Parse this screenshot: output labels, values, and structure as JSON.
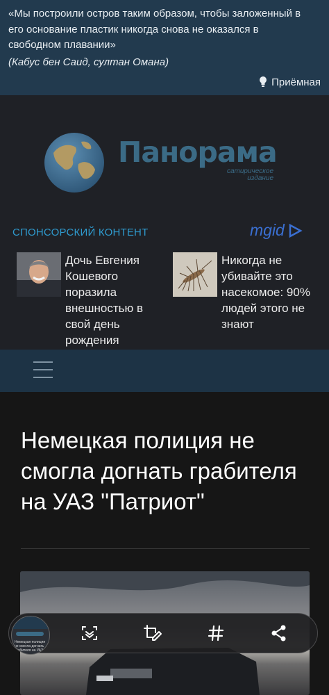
{
  "quote": {
    "text": "«Мы построили остров таким образом, чтобы заложенный в его основание пластик никогда снова не оказался в свободном плавании»",
    "author": "(Кабус бен Саид, султан Омана)",
    "reception_label": "Приёмная"
  },
  "logo": {
    "title": "Панорама",
    "subtitle_line1": "сатирическое",
    "subtitle_line2": "издание"
  },
  "sponsored": {
    "label": "СПОНСОРСКИЙ КОНТЕНТ",
    "network": "mgid",
    "ads": [
      {
        "title": "Дочь Евгения Кошевого поразила внешностью в свой день рождения"
      },
      {
        "title": "Никогда не убивайте это насекомое: 90% людей этого не знают"
      }
    ]
  },
  "article": {
    "title": "Немецкая полиция не смогла догнать грабителя на УАЗ \"Патриот\""
  },
  "toolbar": {
    "thumb_text": "Немецкая полиция не смогла догнать грабителя на УАЗ"
  },
  "colors": {
    "quote_bg": "#223a4e",
    "band_bg": "#1f2126",
    "nav_bg": "#1d3345",
    "accent": "#2f9bcf",
    "logo": "#3b6b86",
    "page_bg": "#161616"
  },
  "icons": [
    "bulb-icon",
    "globe-logo",
    "mgid-play-icon",
    "menu-icon",
    "scan-icon",
    "crop-edit-icon",
    "hashtag-icon",
    "share-icon"
  ]
}
